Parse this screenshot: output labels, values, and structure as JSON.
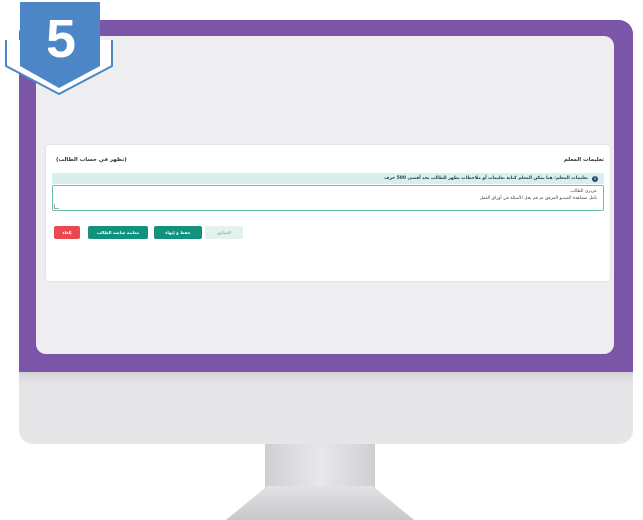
{
  "step_badge": {
    "number": "5"
  },
  "teacher_panel": {
    "title": "تعليمات المعلم",
    "visibility_note": "(تظهر في حساب الطالب)",
    "info_text": "تعليمات المعلم: هنا يمكن المعلم كتابة تعليمات أو ملاحظات تظهر للطالب بحد أقصى 500 حرف",
    "notes_value_line1": "عزيزي الطالب",
    "notes_value_line2": "تأمل مشاهدة الفيديو المرفق ثم قم بحل الأسئلة في أوراق العمل"
  },
  "actions": {
    "exit_label": "إلغاء",
    "preview_label": "معاينة شاشة الطالب",
    "save_label": "حفظ و إنهاء",
    "previous_label": "السابق"
  },
  "colors": {
    "monitor_frame": "#7a55a8",
    "badge_fill": "#4d86c6",
    "primary_button": "#12917d",
    "danger_button": "#e94a4f"
  }
}
